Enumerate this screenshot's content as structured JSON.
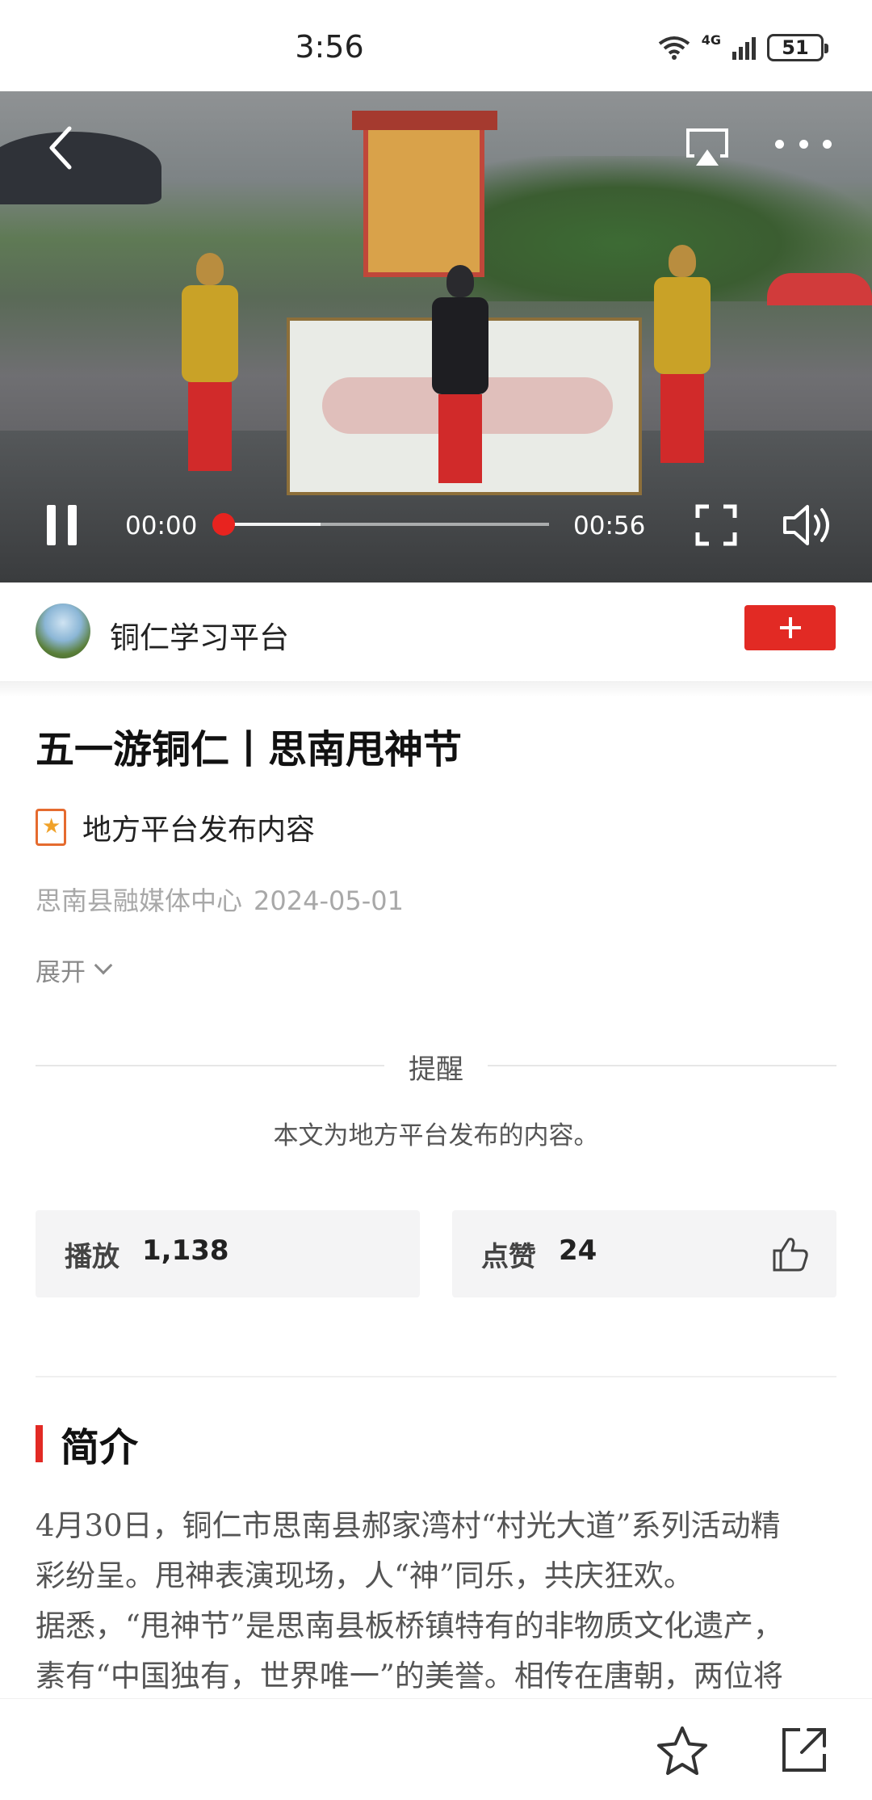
{
  "status_bar": {
    "time": "3:56",
    "network": "4G",
    "battery": "51"
  },
  "video": {
    "current_time": "00:00",
    "total_time": "00:56",
    "progress": 0,
    "icons": {
      "back": "chevron-left-icon",
      "cast": "airplay-icon",
      "more": "more-horizontal-icon",
      "pause": "pause-icon",
      "fullscreen": "fullscreen-icon",
      "volume": "volume-icon"
    }
  },
  "account": {
    "name": "铜仁学习平台",
    "follow_icon": "plus-icon",
    "follow_color": "#e22a24"
  },
  "article": {
    "title": "五一游铜仁丨思南甩神节",
    "source_tag": "地方平台发布内容",
    "publisher": "思南县融媒体中心",
    "date": "2024-05-01",
    "expand_label": "展开"
  },
  "notice": {
    "title": "提醒",
    "text": "本文为地方平台发布的内容。"
  },
  "stats": {
    "play_label": "播放",
    "play_count": "1,138",
    "like_label": "点赞",
    "like_count": "24"
  },
  "intro": {
    "heading": "简介",
    "lines": [
      "4月30日，铜仁市思南县郝家湾村“村光大道”系列活动精",
      "彩纷呈。甩神表演现场，人“神”同乐，共庆狂欢。",
      "据悉，“甩神节”是思南县板桥镇特有的非物质文化遗产，",
      "素有“中国独有，世界唯一”的美誉。相传在唐朝，两位将"
    ]
  },
  "bottom_bar": {
    "favorite_icon": "star-icon",
    "share_icon": "share-icon"
  },
  "colors": {
    "accent": "#e22a24",
    "muted_text": "#a8a8a8"
  }
}
